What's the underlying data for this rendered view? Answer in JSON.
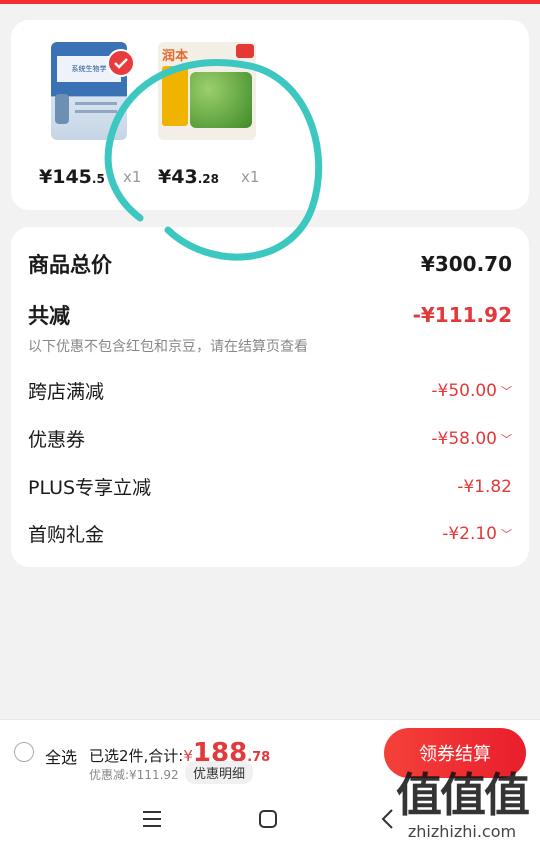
{
  "products": [
    {
      "name": "product-biology-book",
      "price_symbol": "¥",
      "price_int": "145",
      "price_dec": ".5",
      "qty": "x1",
      "selected": true
    },
    {
      "name": "product-mosquito-repellent",
      "price_symbol": "¥",
      "price_int": "43",
      "price_dec": ".28",
      "qty": "x1",
      "selected": false
    }
  ],
  "product_images": {
    "book_title": "系统生物学",
    "brand": "润本"
  },
  "summary": {
    "total_label": "商品总价",
    "total_value": "¥300.70",
    "reduce_label": "共减",
    "reduce_value": "-¥111.92",
    "note": "以下优惠不包含红包和京豆，请在结算页查看",
    "items": [
      {
        "label": "跨店满减",
        "value": "-¥50.00",
        "has_chevron": true
      },
      {
        "label": "优惠券",
        "value": "-¥58.00",
        "has_chevron": true
      },
      {
        "label": "PLUS专享立减",
        "value": "-¥1.82",
        "has_chevron": false
      },
      {
        "label": "首购礼金",
        "value": "-¥2.10",
        "has_chevron": true
      }
    ]
  },
  "bottom": {
    "select_all": "全选",
    "selected_prefix": "已选2件,合计:",
    "currency": "¥",
    "total_int": "188",
    "total_dec": ".78",
    "discount_text": "优惠减:¥111.92",
    "detail_button": "优惠明细",
    "checkout_button": "领券结算"
  },
  "watermark": {
    "logo": "值值值",
    "text": "zhizhizhi.com"
  },
  "colors": {
    "accent": "#e4393c",
    "annotation": "#3cc8c0"
  }
}
